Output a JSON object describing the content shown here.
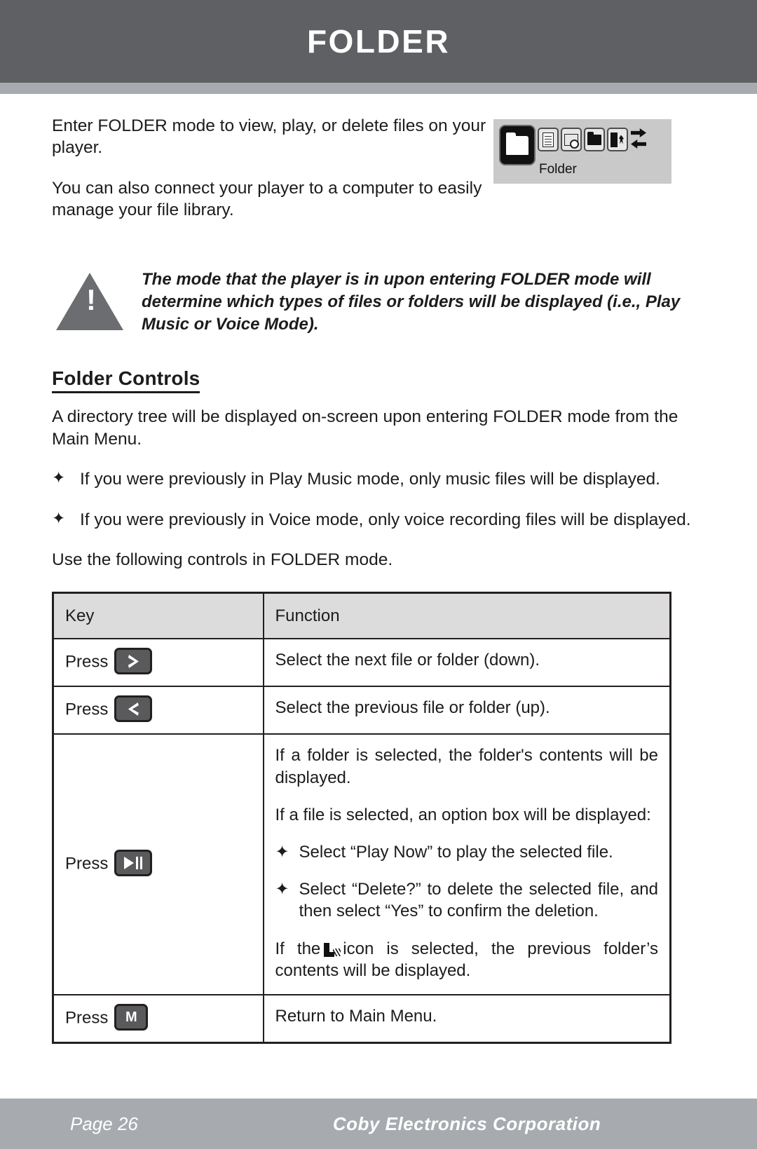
{
  "header": {
    "title": "FOLDER"
  },
  "intro": {
    "paragraph_1": "Enter FOLDER mode to view, play, or delete files on your player.",
    "paragraph_2": "You can also connect your player to a computer to easily manage your file library."
  },
  "device_screenshot": {
    "label": "Folder",
    "icons": [
      "folder-large-selected",
      "document-list",
      "folder-browse",
      "folder-solid",
      "exit-person",
      "arrow-right",
      "arrow-left"
    ]
  },
  "note": {
    "text": "The mode that the player is in upon entering FOLDER mode will determine which types of files or folders will be displayed (i.e., Play Music or Voice Mode)."
  },
  "section": {
    "heading": "Folder Controls",
    "intro": "A directory tree will be displayed on-screen upon entering FOLDER mode from the Main Menu.",
    "bullets": [
      "If you were previously in Play Music mode, only music files will be displayed.",
      "If you were previously in Voice mode, only voice recording files will be displayed."
    ],
    "closing": "Use the following controls in FOLDER mode."
  },
  "table": {
    "headers": [
      "Key",
      "Function"
    ],
    "rows": [
      {
        "key_prefix": "Press",
        "key_button": "next-chevron-right",
        "function_paragraphs": [
          "Select the next file or folder (down)."
        ]
      },
      {
        "key_prefix": "Press",
        "key_button": "previous-chevron-left",
        "function_paragraphs": [
          "Select the previous file or folder (up)."
        ]
      },
      {
        "key_prefix": "Press",
        "key_button": "play-pause",
        "function_paragraphs": [
          "If a folder is selected, the folder's contents will be displayed.",
          "If a file is selected, an option box will be displayed:"
        ],
        "function_bullets": [
          "Select “Play Now” to play the selected file.",
          "Select “Delete?” to delete the selected file, and then select “Yes” to confirm the deletion."
        ],
        "function_trailing_before_icon": "If the",
        "function_trailing_after_icon": "icon is selected, the previous folder’s contents will be displayed."
      },
      {
        "key_prefix": "Press",
        "key_button": "menu-m",
        "key_button_label": "M",
        "function_paragraphs": [
          "Return to Main Menu."
        ]
      }
    ]
  },
  "footer": {
    "page": "Page 26",
    "company": "Coby Electronics Corporation"
  },
  "colors": {
    "header_bg": "#5e6063",
    "accent_bar": "#a7abaf",
    "table_header_bg": "#dcdcdc",
    "key_button": "#5a5a5c",
    "footer_bg": "#a7abaf"
  },
  "glyphs": {
    "star_bullet": "✦",
    "warning": "!"
  }
}
